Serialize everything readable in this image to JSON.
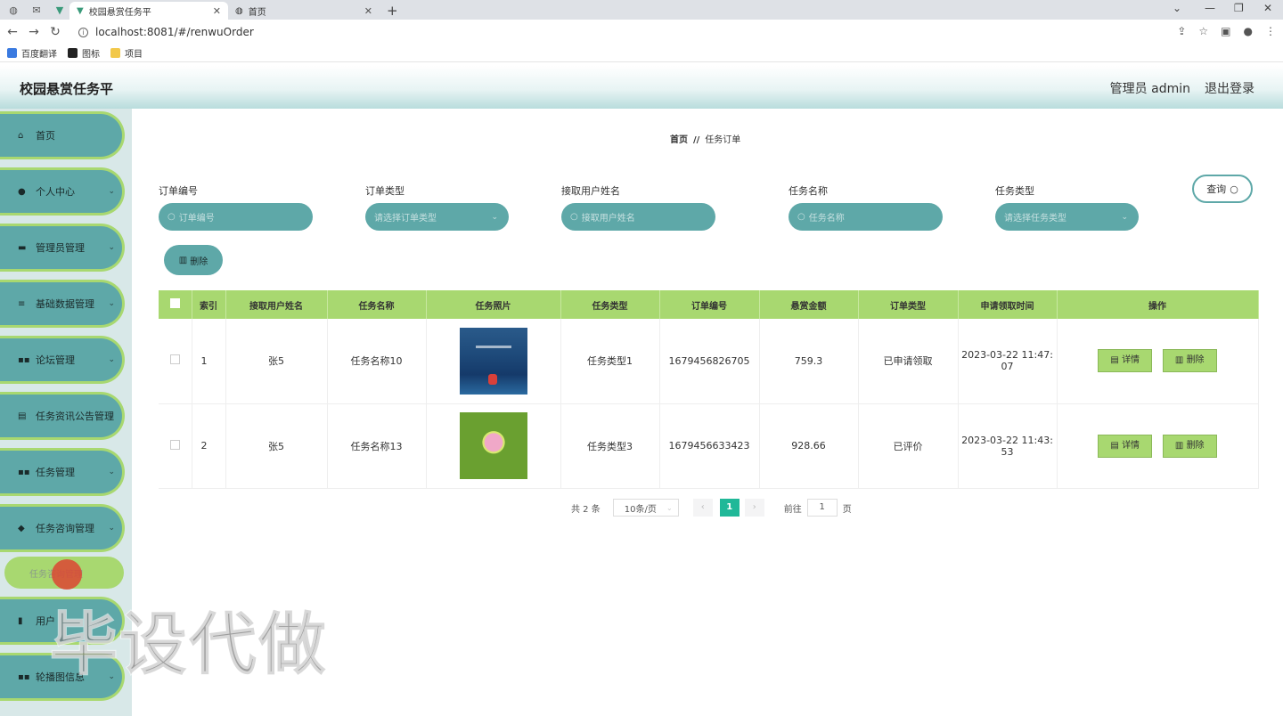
{
  "browser": {
    "tabs": [
      {
        "label": "校园悬赏任务平",
        "active": true
      },
      {
        "label": "首页",
        "active": false
      }
    ],
    "url": "localhost:8081/#/renwuOrder",
    "bookmarks": [
      "百度翻译",
      "图标",
      "项目"
    ]
  },
  "header": {
    "title": "校园悬赏任务平",
    "admin": "管理员 admin",
    "logout": "退出登录"
  },
  "sidebar": {
    "items": [
      {
        "label": "首页",
        "icon": "home-icon"
      },
      {
        "label": "个人中心",
        "icon": "user-icon"
      },
      {
        "label": "管理员管理",
        "icon": "chat-icon"
      },
      {
        "label": "基础数据管理",
        "icon": "menu-icon"
      },
      {
        "label": "论坛管理",
        "icon": "grid-icon"
      },
      {
        "label": "任务资讯公告管理",
        "icon": "doc-icon"
      },
      {
        "label": "任务管理",
        "icon": "grid-icon"
      },
      {
        "label": "任务咨询管理",
        "icon": "pin-icon"
      },
      {
        "label": "用户",
        "icon": "chart-icon"
      },
      {
        "label": "轮播图信息",
        "icon": "grid-icon"
      }
    ],
    "submenu": "任务咨询管理"
  },
  "breadcrumb": {
    "home": "首页",
    "sep": "//",
    "current": "任务订单"
  },
  "filters": [
    {
      "label": "订单编号",
      "placeholder": "订单编号"
    },
    {
      "label": "订单类型",
      "placeholder": "请选择订单类型"
    },
    {
      "label": "接取用户姓名",
      "placeholder": "接取用户姓名"
    },
    {
      "label": "任务名称",
      "placeholder": "任务名称"
    },
    {
      "label": "任务类型",
      "placeholder": "请选择任务类型"
    }
  ],
  "buttons": {
    "query": "查询",
    "delete": "删除",
    "detail": "详情"
  },
  "table": {
    "headers": [
      "索引",
      "接取用户姓名",
      "任务名称",
      "任务照片",
      "任务类型",
      "订单编号",
      "悬赏金额",
      "订单类型",
      "申请领取时间",
      "操作"
    ],
    "rows": [
      {
        "index": "1",
        "user": "张5",
        "task": "任务名称10",
        "type": "任务类型1",
        "order_no": "1679456826705",
        "amount": "759.3",
        "order_type": "已申请领取",
        "time_date": "2023-03-22 11:47:",
        "time_sec": "07"
      },
      {
        "index": "2",
        "user": "张5",
        "task": "任务名称13",
        "type": "任务类型3",
        "order_no": "1679456633423",
        "amount": "928.66",
        "order_type": "已评价",
        "time_date": "2023-03-22 11:43:",
        "time_sec": "53"
      }
    ]
  },
  "pager": {
    "total": "共 2 条",
    "size": "10条/页",
    "current": "1",
    "goto": "前往",
    "page_input": "1",
    "page_unit": "页"
  },
  "watermark": "毕设代做",
  "colors": {
    "teal": "#5ea8a8",
    "green": "#a8d870",
    "pager_active": "#20b898"
  }
}
